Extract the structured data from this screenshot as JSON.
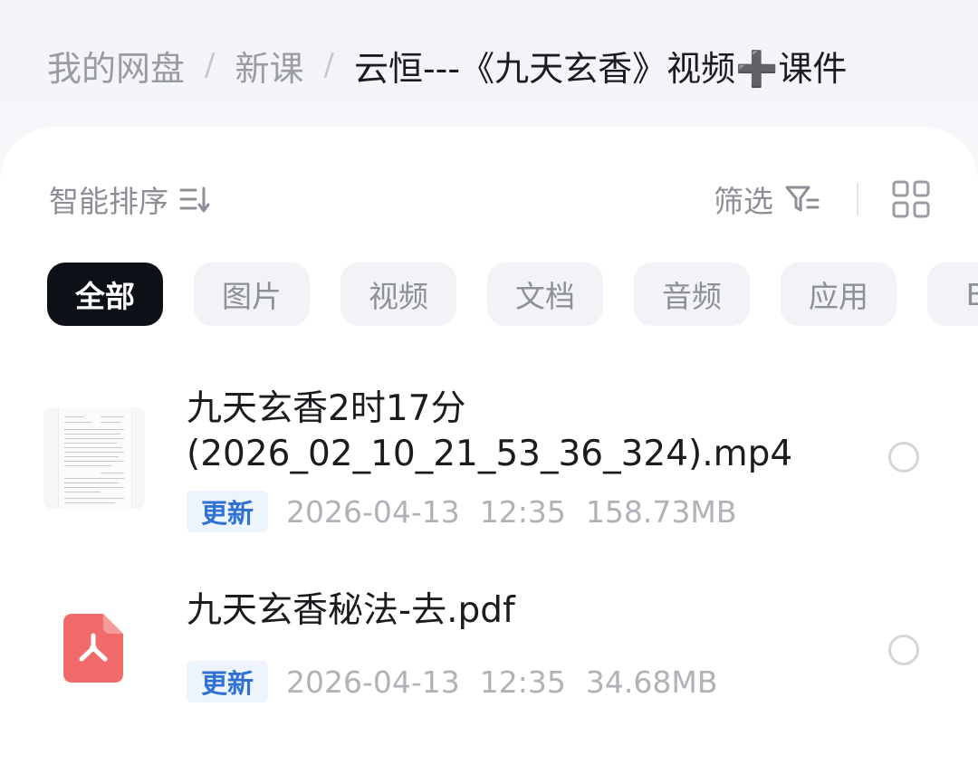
{
  "breadcrumb": {
    "root": "我的网盘",
    "separator": "/",
    "parent": "新课",
    "current": "云恒---《九天玄香》视频➕课件"
  },
  "toolbar": {
    "sort_label": "智能排序",
    "sort_icon": "sort-lines-icon",
    "filter_label": "筛选",
    "filter_icon": "funnel-icon",
    "view_icon": "grid-view-icon"
  },
  "tabs": [
    {
      "label": "全部",
      "active": true
    },
    {
      "label": "图片",
      "active": false
    },
    {
      "label": "视频",
      "active": false
    },
    {
      "label": "文档",
      "active": false
    },
    {
      "label": "音频",
      "active": false
    },
    {
      "label": "应用",
      "active": false
    },
    {
      "label": "BT",
      "active": false
    }
  ],
  "files": [
    {
      "name": "九天玄香2时17分\n(2026_02_10_21_53_36_324).mp4",
      "badge": "更新",
      "date": "2026-04-13",
      "time": "12:35",
      "size": "158.73MB",
      "thumb": "document-thumbnail",
      "selected": false
    },
    {
      "name": "九天玄香秘法-去.pdf",
      "badge": "更新",
      "date": "2026-04-13",
      "time": "12:35",
      "size": "34.68MB",
      "thumb": "pdf-icon",
      "selected": false
    }
  ],
  "colors": {
    "active_tab_bg": "#0c1118",
    "badge_text": "#2f72d3",
    "badge_bg": "#eef4fc",
    "pdf_icon": "#f26b6b"
  }
}
